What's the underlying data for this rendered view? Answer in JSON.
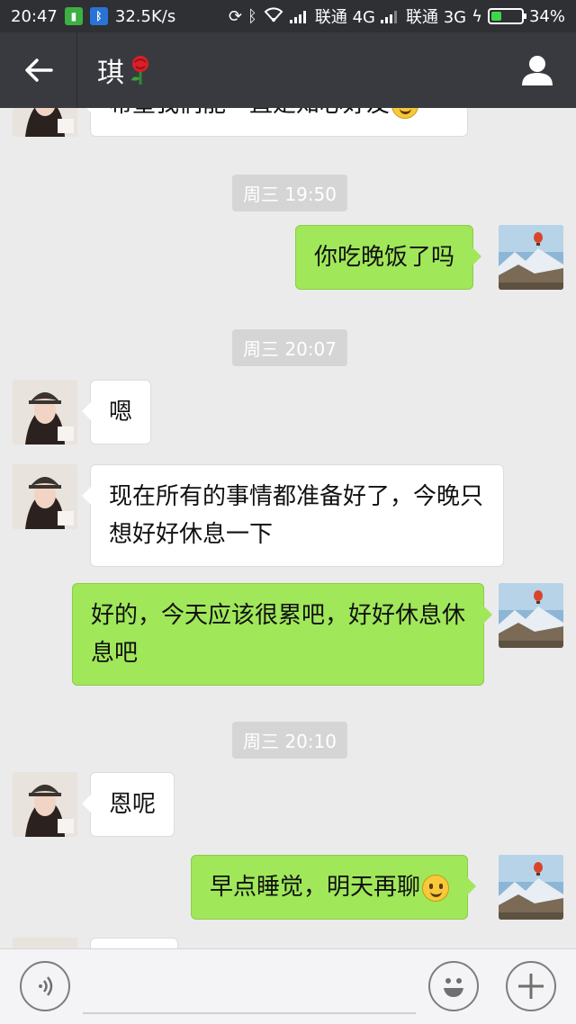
{
  "status_bar": {
    "time": "20:47",
    "net_speed": "32.5K/s",
    "carrier1": "联通 4G",
    "carrier2": "联通 3G",
    "battery_text": "34%",
    "battery_level": 0.34
  },
  "header": {
    "back_icon": "arrow-left-icon",
    "title": "琪",
    "title_icon": "rose-icon",
    "profile_icon": "person-icon"
  },
  "messages": [
    {
      "type": "text",
      "side": "in",
      "text": "希望我们能一直是知心好友",
      "emoji": "smiley-icon"
    },
    {
      "type": "time",
      "text": "周三 19:50"
    },
    {
      "type": "text",
      "side": "out",
      "text": "你吃晚饭了吗"
    },
    {
      "type": "time",
      "text": "周三 20:07"
    },
    {
      "type": "text",
      "side": "in",
      "text": "嗯"
    },
    {
      "type": "text",
      "side": "in",
      "text": "现在所有的事情都准备好了，今晚只想好好休息一下"
    },
    {
      "type": "text",
      "side": "out",
      "text": "好的，今天应该很累吧，好好休息休息吧"
    },
    {
      "type": "time",
      "text": "周三 20:10"
    },
    {
      "type": "text",
      "side": "in",
      "text": "恩呢"
    },
    {
      "type": "text",
      "side": "out",
      "text": "早点睡觉，明天再聊",
      "emoji": "smiley-icon"
    }
  ],
  "input_bar": {
    "voice_icon": "voice-icon",
    "emoji_icon": "emoji-icon",
    "plus_icon": "plus-icon",
    "text_value": ""
  },
  "colors": {
    "chat_bg": "#ebebeb",
    "header_bg": "#393a3f",
    "out_bubble": "#a0e75a",
    "in_bubble": "#ffffff"
  }
}
